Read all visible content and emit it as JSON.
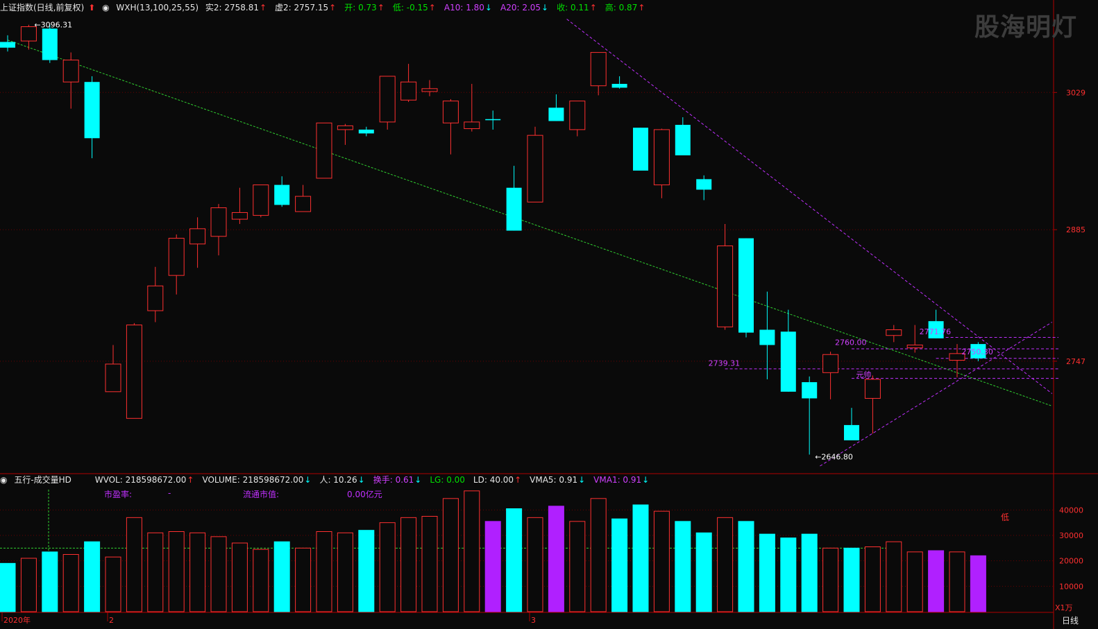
{
  "header": {
    "symbol": "上证指数(日线,前复权)",
    "indicator": "WXH(13,100,25,55)",
    "items": [
      {
        "label": "实2: 2758.81",
        "arrow": "↑",
        "color": "w"
      },
      {
        "label": "虚2: 2757.15",
        "arrow": "↑",
        "color": "w"
      },
      {
        "label": "开: 0.73",
        "arrow": "↑",
        "color": "g"
      },
      {
        "label": "低: -0.15",
        "arrow": "↑",
        "color": "g"
      },
      {
        "label": "A10: 1.80",
        "arrow": "↓",
        "color": "m"
      },
      {
        "label": "A20: 2.05",
        "arrow": "↓",
        "color": "m"
      },
      {
        "label": "收: 0.11",
        "arrow": "↑",
        "color": "g"
      },
      {
        "label": "高: 0.87",
        "arrow": "↑",
        "color": "g"
      }
    ],
    "watermark": "股海明灯"
  },
  "volume_header": {
    "title": "五行-成交量HD",
    "items": [
      {
        "label": "WVOL: 218598672.00",
        "arrow": "↑",
        "color": "w"
      },
      {
        "label": "VOLUME: 218598672.00",
        "arrow": "↓",
        "color": "w"
      },
      {
        "label": "人: 10.26",
        "arrow": "↓",
        "color": "w"
      },
      {
        "label": "换手: 0.61",
        "arrow": "↓",
        "color": "m"
      },
      {
        "label": "LG: 0.00",
        "arrow": "",
        "color": "g"
      },
      {
        "label": "LD: 40.00",
        "arrow": "↑",
        "color": "w"
      },
      {
        "label": "VMA5: 0.91",
        "arrow": "↓",
        "color": "w"
      },
      {
        "label": "VMA1: 0.91",
        "arrow": "↓",
        "color": "m"
      }
    ],
    "pe_label": "市盈率:",
    "pe_value": "-",
    "mcap_label": "流通市值:",
    "mcap_value": "0.00亿元"
  },
  "chart_data": {
    "type": "candlestick",
    "price_axis": {
      "ticks": [
        3029,
        2885,
        2747
      ],
      "range": [
        2637,
        3110
      ]
    },
    "volume_axis": {
      "ticks": [
        40000,
        30000,
        20000,
        10000
      ],
      "unit": "X1万",
      "range": [
        0,
        48000
      ]
    },
    "x_labels": [
      {
        "label": "2020年",
        "index": 0
      },
      {
        "label": "2",
        "index": 5
      },
      {
        "label": "3",
        "index": 25
      }
    ],
    "period_label": "日线",
    "candles": [
      {
        "o": 3076,
        "c": 3082,
        "h": 3089,
        "l": 3072,
        "v": 19000,
        "dir": "down"
      },
      {
        "o": 3083,
        "c": 3098,
        "h": 3100,
        "l": 3074,
        "v": 21000,
        "dir": "up"
      },
      {
        "o": 3096,
        "c": 3063,
        "h": 3100,
        "l": 3060,
        "v": 23500,
        "dir": "down"
      },
      {
        "o": 3040,
        "c": 3063,
        "h": 3071,
        "l": 3012,
        "v": 22500,
        "dir": "up"
      },
      {
        "o": 3040,
        "c": 2981,
        "h": 3046,
        "l": 2960,
        "v": 27500,
        "dir": "down"
      },
      {
        "o": 2715,
        "c": 2744,
        "h": 2764,
        "l": 2715,
        "v": 21500,
        "dir": "up"
      },
      {
        "o": 2687,
        "c": 2785,
        "h": 2787,
        "l": 2687,
        "v": 37000,
        "dir": "up"
      },
      {
        "o": 2800,
        "c": 2826,
        "h": 2846,
        "l": 2788,
        "v": 31000,
        "dir": "up"
      },
      {
        "o": 2837,
        "c": 2876,
        "h": 2880,
        "l": 2817,
        "v": 31500,
        "dir": "up"
      },
      {
        "o": 2870,
        "c": 2886,
        "h": 2898,
        "l": 2845,
        "v": 31000,
        "dir": "up"
      },
      {
        "o": 2878,
        "c": 2908,
        "h": 2912,
        "l": 2858,
        "v": 29500,
        "dir": "up"
      },
      {
        "o": 2896,
        "c": 2903,
        "h": 2929,
        "l": 2891,
        "v": 27000,
        "dir": "up"
      },
      {
        "o": 2900,
        "c": 2932,
        "h": 2932,
        "l": 2898,
        "v": 24500,
        "dir": "up"
      },
      {
        "o": 2932,
        "c": 2911,
        "h": 2941,
        "l": 2909,
        "v": 27500,
        "dir": "down"
      },
      {
        "o": 2904,
        "c": 2920,
        "h": 2932,
        "l": 2904,
        "v": 25000,
        "dir": "up"
      },
      {
        "o": 2939,
        "c": 2997,
        "h": 2997,
        "l": 2939,
        "v": 31500,
        "dir": "up"
      },
      {
        "o": 2990,
        "c": 2994,
        "h": 2996,
        "l": 2974,
        "v": 31000,
        "dir": "up"
      },
      {
        "o": 2990,
        "c": 2986,
        "h": 2993,
        "l": 2983,
        "v": 32000,
        "dir": "down"
      },
      {
        "o": 2998,
        "c": 3046,
        "h": 3046,
        "l": 2990,
        "v": 35000,
        "dir": "up"
      },
      {
        "o": 3021,
        "c": 3040,
        "h": 3059,
        "l": 3019,
        "v": 37000,
        "dir": "up"
      },
      {
        "o": 3030,
        "c": 3033,
        "h": 3042,
        "l": 3025,
        "v": 37500,
        "dir": "up"
      },
      {
        "o": 2997,
        "c": 3020,
        "h": 3022,
        "l": 2964,
        "v": 44500,
        "dir": "up"
      },
      {
        "o": 2991,
        "c": 2998,
        "h": 3038,
        "l": 2988,
        "v": 47500,
        "dir": "up"
      },
      {
        "o": 3001,
        "c": 3000,
        "h": 3010,
        "l": 2990,
        "v": 35500,
        "dir": "purple"
      },
      {
        "o": 2929,
        "c": 2884,
        "h": 2952,
        "l": 2884,
        "v": 40500,
        "dir": "down"
      },
      {
        "o": 2914,
        "c": 2984,
        "h": 2993,
        "l": 2914,
        "v": 37000,
        "dir": "up"
      },
      {
        "o": 3013,
        "c": 2999,
        "h": 3027,
        "l": 2999,
        "v": 41500,
        "dir": "purple"
      },
      {
        "o": 2990,
        "c": 3020,
        "h": 3020,
        "l": 2983,
        "v": 35500,
        "dir": "up"
      },
      {
        "o": 3036,
        "c": 3071,
        "h": 3071,
        "l": 3026,
        "v": 44500,
        "dir": "up"
      },
      {
        "o": 3034,
        "c": 3038,
        "h": 3046,
        "l": 3033,
        "v": 36500,
        "dir": "down"
      },
      {
        "o": 2992,
        "c": 2947,
        "h": 2992,
        "l": 2947,
        "v": 42000,
        "dir": "down"
      },
      {
        "o": 2932,
        "c": 2990,
        "h": 2991,
        "l": 2918,
        "v": 39500,
        "dir": "up"
      },
      {
        "o": 2995,
        "c": 2963,
        "h": 3003,
        "l": 2963,
        "v": 35500,
        "dir": "down"
      },
      {
        "o": 2938,
        "c": 2927,
        "h": 2942,
        "l": 2916,
        "v": 31000,
        "dir": "down"
      },
      {
        "o": 2783,
        "c": 2868,
        "h": 2891,
        "l": 2780,
        "v": 37000,
        "dir": "up"
      },
      {
        "o": 2876,
        "c": 2777,
        "h": 2876,
        "l": 2772,
        "v": 35500,
        "dir": "down"
      },
      {
        "o": 2780,
        "c": 2764,
        "h": 2820,
        "l": 2728,
        "v": 30500,
        "dir": "down"
      },
      {
        "o": 2778,
        "c": 2715,
        "h": 2801,
        "l": 2715,
        "v": 29000,
        "dir": "down"
      },
      {
        "o": 2725,
        "c": 2708,
        "h": 2731,
        "l": 2649,
        "v": 30500,
        "dir": "down"
      },
      {
        "o": 2735,
        "c": 2754,
        "h": 2757,
        "l": 2707,
        "v": 25000,
        "dir": "up"
      },
      {
        "o": 2680,
        "c": 2664,
        "h": 2698,
        "l": 2666,
        "v": 25000,
        "dir": "down"
      },
      {
        "o": 2708,
        "c": 2728,
        "h": 2732,
        "l": 2671,
        "v": 25500,
        "dir": "up"
      },
      {
        "o": 2774,
        "c": 2780,
        "h": 2785,
        "l": 2767,
        "v": 27500,
        "dir": "up"
      },
      {
        "o": 2764,
        "c": 2761,
        "h": 2785,
        "l": 2756,
        "v": 23500,
        "dir": "up"
      },
      {
        "o": 2789,
        "c": 2771,
        "h": 2801,
        "l": 2771,
        "v": 24000,
        "dir": "purple"
      },
      {
        "o": 2748,
        "c": 2755,
        "h": 2765,
        "l": 2730,
        "v": 23500,
        "dir": "up"
      },
      {
        "o": 2765,
        "c": 2750,
        "h": 2767,
        "l": 2747,
        "v": 22000,
        "dir": "purple"
      }
    ],
    "annotations": [
      {
        "text": "3096.31",
        "price": 3100,
        "index": 1,
        "arrow": "←",
        "color": "#ffffff"
      },
      {
        "text": "2646.80",
        "price": 2647,
        "index": 38,
        "arrow": "←",
        "color": "#ffffff"
      },
      {
        "text": "2771.76",
        "price": 2778,
        "index": 44,
        "arrow": "",
        "color": "#d040ff"
      },
      {
        "text": "2760.00",
        "price": 2767,
        "index": 40,
        "arrow": "",
        "color": "#d040ff"
      },
      {
        "text": "2750.30",
        "price": 2757,
        "index": 46,
        "arrow": "",
        "color": "#d040ff"
      },
      {
        "text": "2739.31",
        "price": 2745,
        "index": 34,
        "arrow": "",
        "color": "#d040ff"
      },
      {
        "text": "元帅",
        "price": 2733,
        "index": 41,
        "arrow": "",
        "color": "#d040ff"
      }
    ],
    "levels": [
      {
        "price": 2772,
        "from": 44,
        "to": 50
      },
      {
        "price": 2760,
        "from": 40,
        "to": 50
      },
      {
        "price": 2750,
        "from": 44,
        "to": 50
      },
      {
        "price": 2739,
        "from": 34,
        "to": 50
      },
      {
        "price": 2729,
        "from": 40,
        "to": 50
      }
    ],
    "side_label": "低"
  }
}
